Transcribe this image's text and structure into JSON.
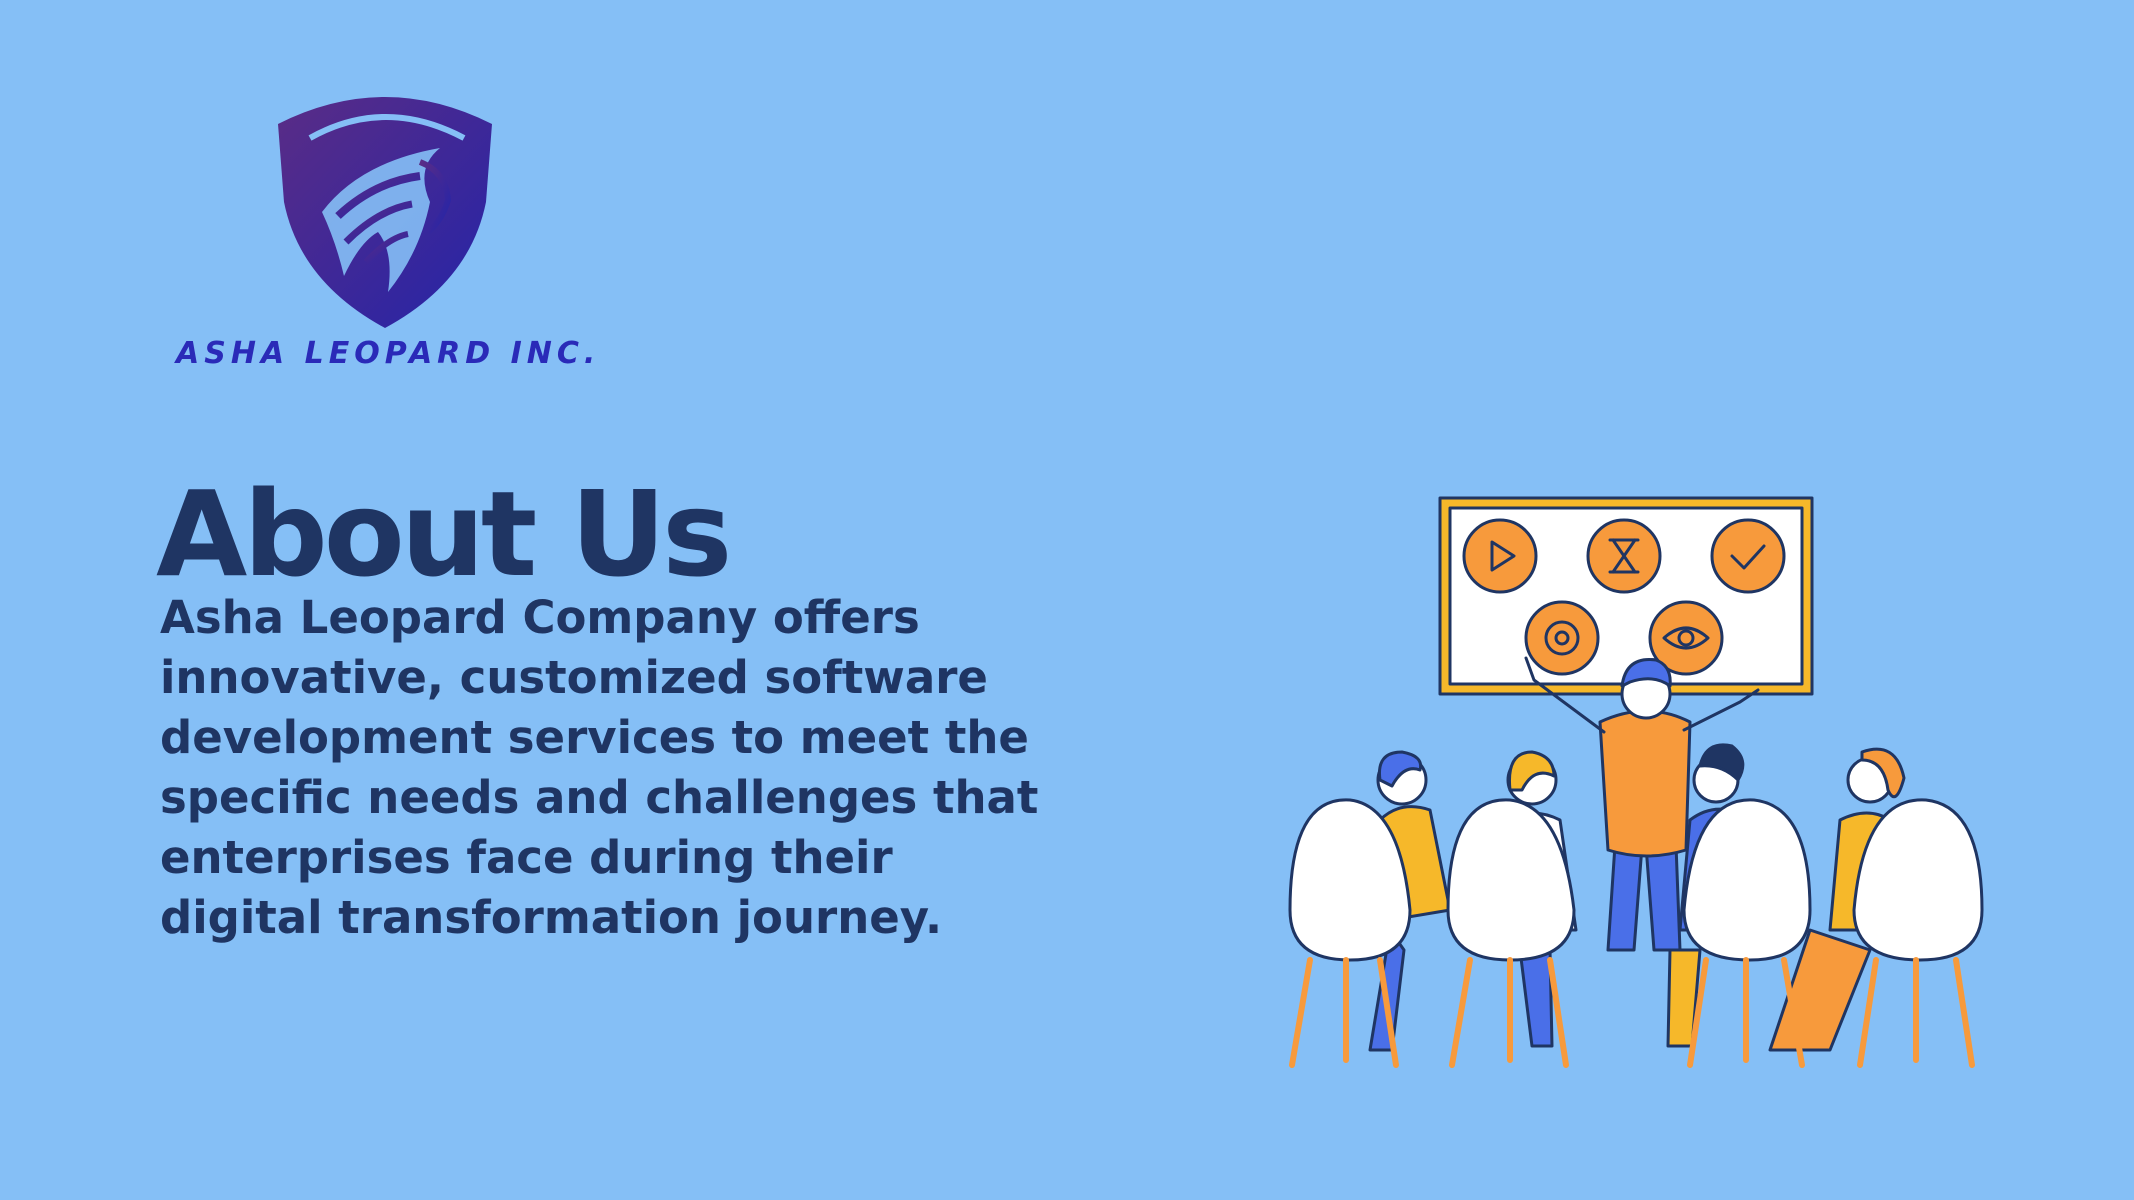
{
  "brand": {
    "name": "ASHA LEOPARD INC.",
    "logo_icon": "leopard-shield-logo",
    "logo_colors": [
      "#5B2D82",
      "#2222AA"
    ]
  },
  "heading": "About Us",
  "description": "Asha Leopard Company offers innovative, customized software development services to meet the specific needs and challenges that enterprises face during their digital transformation journey.",
  "illustration": {
    "subject": "team-meeting-presentation",
    "board_icons": [
      "play-icon",
      "hourglass-icon",
      "check-icon",
      "gear-icon",
      "eye-icon"
    ]
  },
  "colors": {
    "background": "#85BFF6",
    "text": "#1F3563",
    "brand": "#2A2AB8",
    "accent_orange": "#F79A3C",
    "accent_yellow": "#F6B82A",
    "accent_blue": "#4A6FE8"
  }
}
